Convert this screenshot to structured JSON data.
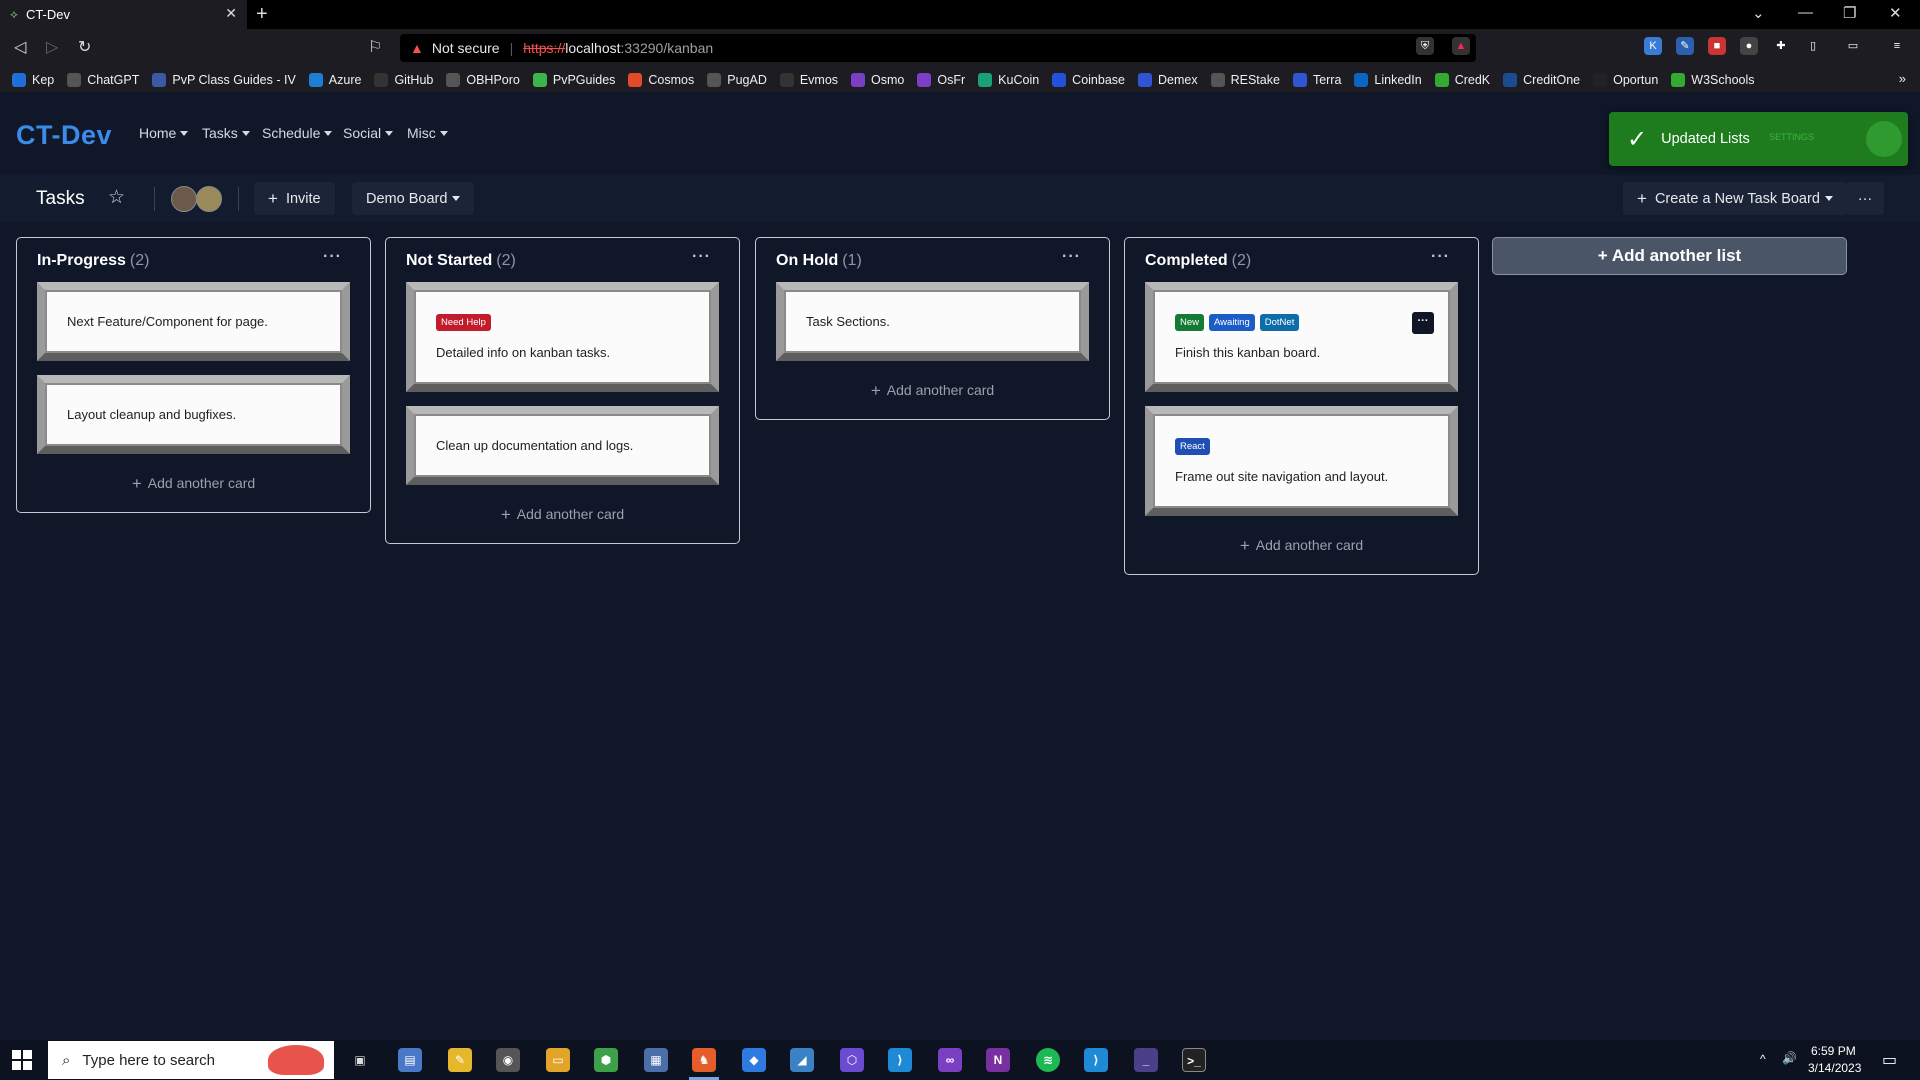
{
  "browser": {
    "tab_title": "CT-Dev",
    "not_secure": "Not secure",
    "url_scheme": "https://",
    "url_host": "localhost",
    "url_path": ":33290/kanban",
    "bookmarks": [
      "Kep",
      "ChatGPT",
      "PvP Class Guides - IV",
      "Azure",
      "GitHub",
      "OBHPoro",
      "PvPGuides",
      "Cosmos",
      "PugAD",
      "Evmos",
      "Osmo",
      "OsFr",
      "KuCoin",
      "Coinbase",
      "Demex",
      "REStake",
      "Terra",
      "LinkedIn",
      "CredK",
      "CreditOne",
      "Oportun",
      "W3Schools"
    ]
  },
  "app": {
    "brand": "CT-Dev",
    "nav": [
      "Home",
      "Tasks",
      "Schedule",
      "Social",
      "Misc"
    ],
    "toast": "Updated Lists",
    "toast_settings": "SETTINGS"
  },
  "board_header": {
    "title": "Tasks",
    "invite": "Invite",
    "board_select": "Demo Board",
    "create_board": "Create a New Task Board",
    "more": "···"
  },
  "lists": [
    {
      "title": "In-Progress",
      "count": "(2)",
      "cards": [
        {
          "text": "Next Feature/Component for page.",
          "badges": []
        },
        {
          "text": "Layout cleanup and bugfixes.",
          "badges": []
        }
      ]
    },
    {
      "title": "Not Started",
      "count": "(2)",
      "cards": [
        {
          "text": "Detailed info on kanban tasks.",
          "badges": [
            {
              "label": "Need Help",
              "color": "#c21b2c"
            }
          ]
        },
        {
          "text": "Clean up documentation and logs.",
          "badges": []
        }
      ]
    },
    {
      "title": "On Hold",
      "count": "(1)",
      "cards": [
        {
          "text": "Task Sections.",
          "badges": []
        }
      ]
    },
    {
      "title": "Completed",
      "count": "(2)",
      "cards": [
        {
          "text": "Finish this kanban board.",
          "badges": [
            {
              "label": "New",
              "color": "#157a33"
            },
            {
              "label": "Awaiting",
              "color": "#1c5cc7"
            },
            {
              "label": "DotNet",
              "color": "#0e6da8"
            }
          ]
        },
        {
          "text": "Frame out site navigation and layout.",
          "badges": [
            {
              "label": "React",
              "color": "#1f4fb4"
            }
          ]
        }
      ]
    }
  ],
  "add_card_label": "Add another card",
  "add_list_label": "Add another list",
  "taskbar": {
    "search_placeholder": "Type here to search",
    "time": "6:59 PM",
    "date": "3/14/2023"
  }
}
